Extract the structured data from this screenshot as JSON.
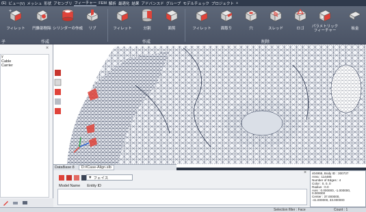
{
  "menu": [
    "(E)",
    "ビュー(V)",
    "メッシュ",
    "形状",
    "アセンブリ",
    "フィーチャー",
    "FEM",
    "解析",
    "最適化",
    "結果",
    "アドバンスド",
    "グループ",
    "モデルチェック",
    "プロジェクト",
    "+"
  ],
  "ribbon": {
    "buttons": [
      "フィレット",
      "円錐部削除",
      "シリンダーの作成",
      "リブ",
      "フィレット",
      "分割",
      "面剪",
      "フィレット",
      "面取り",
      "穴",
      "スレッド",
      "ロゴ",
      "パラメトリック\nフィーチャー",
      "板金"
    ],
    "groups": [
      "子",
      "作成",
      "作成",
      "削除"
    ]
  },
  "left_tree": [
    "y",
    "Cable",
    "Carrier"
  ],
  "database_tabs": [
    "DataBase 8",
    "D:#Case-Align.slb"
  ],
  "bottom_panel": {
    "filter_label": "フェイス",
    "columns": [
      "Model Name",
      "Entity ID"
    ]
  },
  "info_panel": [
    "404955, Body ID : 300737",
    "Area : 114486",
    "Number of Edges : 4",
    "Color : 0, 0, 0",
    "Radius : 0.0",
    "Axis : 0.000000, -1.000000,",
    "0.000000",
    "Center : 37.000000,",
    "-41.000000, 33.000000"
  ],
  "status": {
    "selection_filter": "Selection filter : Face",
    "count": "Count : 1"
  },
  "colors": {
    "menubar": "#2f3a4c",
    "ribbon": "#555e70",
    "mesh_line": "#1f2a44",
    "accent_red": "#e0433a"
  }
}
